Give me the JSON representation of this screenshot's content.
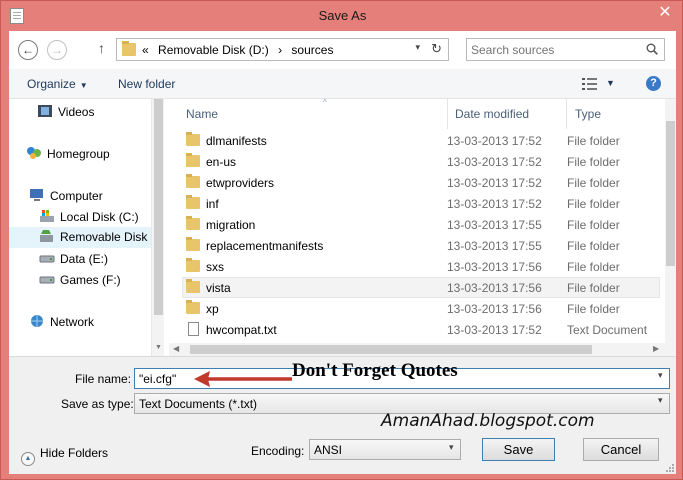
{
  "window": {
    "title": "Save As",
    "close_glyph": "✕"
  },
  "nav": {
    "back_glyph": "←",
    "forward_glyph": "→",
    "up_glyph": "↑",
    "breadcrumb": [
      "«",
      "Removable Disk (D:)",
      "›",
      "sources"
    ],
    "address_dropdown_glyph": "▾",
    "refresh_glyph": "↻",
    "search_placeholder": "Search sources"
  },
  "toolbar": {
    "organize_label": "Organize",
    "organize_caret": "▼",
    "new_folder_label": "New folder",
    "view_caret": "▼",
    "help_label": "?"
  },
  "sidebar": {
    "items": [
      {
        "label": "Videos",
        "icon": "video-icon"
      },
      {
        "label": "Homegroup",
        "icon": "homegroup-icon"
      },
      {
        "label": "Computer",
        "icon": "computer-icon"
      },
      {
        "label": "Local Disk (C:)",
        "icon": "local-disk-icon"
      },
      {
        "label": "Removable Disk (",
        "icon": "removable-disk-icon",
        "selected": true
      },
      {
        "label": "Data (E:)",
        "icon": "drive-icon"
      },
      {
        "label": "Games (F:)",
        "icon": "drive-icon"
      },
      {
        "label": "Network",
        "icon": "network-icon"
      }
    ],
    "scroll_up": "▲",
    "scroll_down": "▼"
  },
  "file_list": {
    "columns": [
      "Name",
      "Date modified",
      "Type"
    ],
    "sort_caret": "^",
    "rows": [
      {
        "name": "dlmanifests",
        "date": "13-03-2013 17:52",
        "type": "File folder",
        "icon": "folder-icon"
      },
      {
        "name": "en-us",
        "date": "13-03-2013 17:52",
        "type": "File folder",
        "icon": "folder-icon"
      },
      {
        "name": "etwproviders",
        "date": "13-03-2013 17:52",
        "type": "File folder",
        "icon": "folder-icon"
      },
      {
        "name": "inf",
        "date": "13-03-2013 17:52",
        "type": "File folder",
        "icon": "folder-icon"
      },
      {
        "name": "migration",
        "date": "13-03-2013 17:55",
        "type": "File folder",
        "icon": "folder-icon"
      },
      {
        "name": "replacementmanifests",
        "date": "13-03-2013 17:55",
        "type": "File folder",
        "icon": "folder-icon"
      },
      {
        "name": "sxs",
        "date": "13-03-2013 17:56",
        "type": "File folder",
        "icon": "folder-icon"
      },
      {
        "name": "vista",
        "date": "13-03-2013 17:56",
        "type": "File folder",
        "icon": "folder-icon",
        "hover": true
      },
      {
        "name": "xp",
        "date": "13-03-2013 17:56",
        "type": "File folder",
        "icon": "folder-icon"
      },
      {
        "name": "hwcompat.txt",
        "date": "13-03-2013 17:52",
        "type": "Text Document",
        "icon": "text-document-icon"
      }
    ],
    "hscroll_left": "◀",
    "hscroll_right": "▶"
  },
  "form": {
    "file_name_label": "File name:",
    "file_name_value": "\"ei.cfg\"",
    "save_as_type_label": "Save as type:",
    "save_as_type_value": "Text Documents (*.txt)",
    "dropdown_glyph": "▾",
    "hide_folders_label": "Hide Folders",
    "hide_folders_glyph": "▲",
    "encoding_label": "Encoding:",
    "encoding_value": "ANSI",
    "save_label": "Save",
    "cancel_label": "Cancel"
  },
  "annotation": {
    "text": "Don't Forget Quotes",
    "watermark": "AmanAhad.blogspot.com",
    "arrow_color": "#c0392b"
  }
}
